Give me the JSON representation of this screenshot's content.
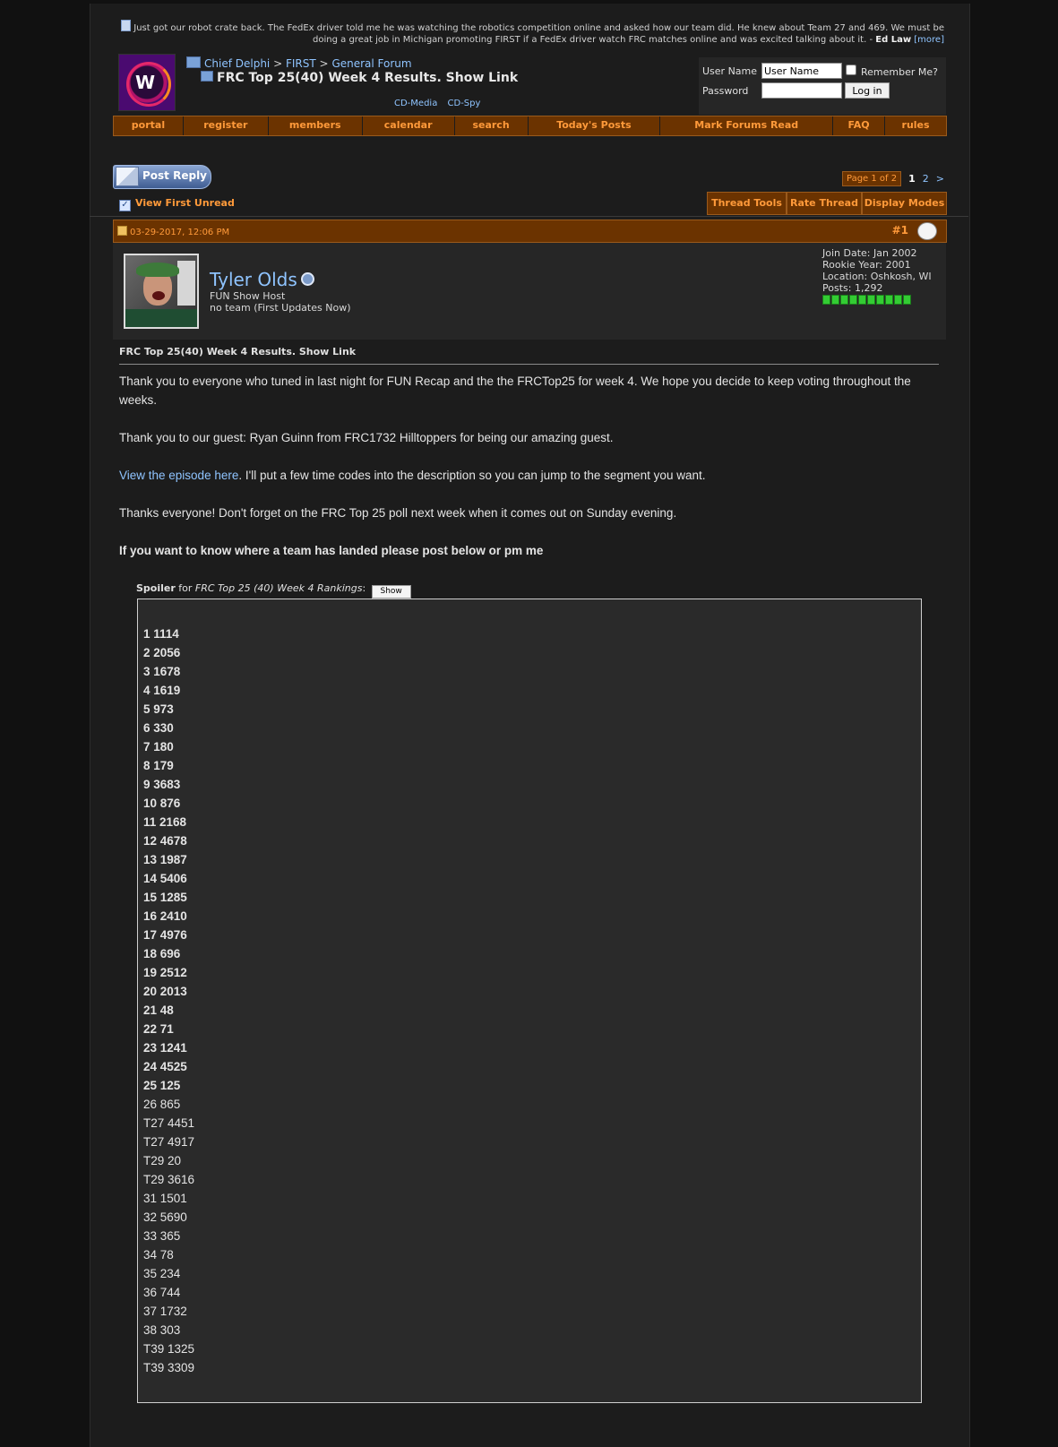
{
  "quote": {
    "text": "Just got our robot crate back. The FedEx driver told me he was watching the robotics competition online and asked how our team did. He knew about Team 27 and 469. We must be doing a great job in Michigan promoting FIRST if a FedEx driver watch FRC matches online and was excited talking about it. - ",
    "author": "Ed Law",
    "more": "[more]"
  },
  "breadcrumb": {
    "site": "Chief Delphi",
    "sep": ">",
    "cat": "FIRST",
    "forum": "General Forum"
  },
  "thread_title": "FRC Top 25(40) Week 4 Results. Show Link",
  "cd_links": [
    "CD-Media",
    "CD-Spy"
  ],
  "login": {
    "username_label": "User Name",
    "username_value": "User Name",
    "remember": "Remember Me?",
    "password_label": "Password",
    "login_button": "Log in"
  },
  "navbar": [
    "portal",
    "register",
    "members",
    "calendar",
    "search",
    "Today's Posts",
    "Mark Forums Read",
    "FAQ",
    "rules"
  ],
  "post_reply": "Post Reply",
  "pager": {
    "label": "Page 1 of 2",
    "current": "1",
    "next_page": "2",
    "next": ">"
  },
  "view_first_unread": "View First Unread",
  "thread_tools": [
    "Thread Tools",
    "Rate Thread",
    "Display Modes"
  ],
  "post": {
    "date": "03-29-2017, 12:06 PM",
    "number": "#1",
    "username": "Tyler Olds",
    "user_title": "FUN Show Host",
    "team": "no team (First Updates Now)",
    "join_date": "Join Date: Jan 2002",
    "rookie_year": "Rookie Year: 2001",
    "location": "Location: Oshkosh, WI",
    "posts": "Posts: 1,292",
    "title": "FRC Top 25(40) Week 4 Results. Show Link",
    "p1": "Thank you to everyone who tuned in last night for FUN Recap and the the FRCTop25 for week 4. We hope you decide to keep voting throughout the weeks.",
    "p2": "Thank you to our guest: Ryan Guinn from FRC1732 Hilltoppers for being our amazing guest.",
    "p3_link": "View the episode here",
    "p3_rest": ". I'll put a few time codes into the description so you can jump to the segment you want.",
    "p4": "Thanks everyone! Don't forget on the FRC Top 25 poll next week when it comes out on Sunday evening.",
    "p5": "If you want to know where a team has landed please post below or pm me",
    "spoiler_label": "Spoiler",
    "spoiler_for": "for",
    "spoiler_title": "FRC Top 25 (40) Week 4 Rankings",
    "spoiler_colon": ":",
    "spoiler_button": "Show"
  },
  "rankings_bold": [
    "1 1114",
    "2 2056",
    "3 1678",
    "4 1619",
    "5 973",
    "6 330",
    "7 180",
    "8 179",
    "9 3683",
    "10 876",
    "11 2168",
    "12 4678",
    "13 1987",
    "14 5406",
    "15 1285",
    "16 2410",
    "17 4976",
    "18 696",
    "19 2512",
    "20 2013",
    "21 48",
    "22 71",
    "23 1241",
    "24 4525",
    "25 125"
  ],
  "rankings_rest": [
    "26 865",
    "T27 4451",
    "T27 4917",
    "T29 20",
    "T29 3616",
    "31 1501",
    "32 5690",
    "33 365",
    "34 78",
    "35 234",
    "36 744",
    "37 1732",
    "38 303",
    "T39 1325",
    "T39 3309"
  ]
}
